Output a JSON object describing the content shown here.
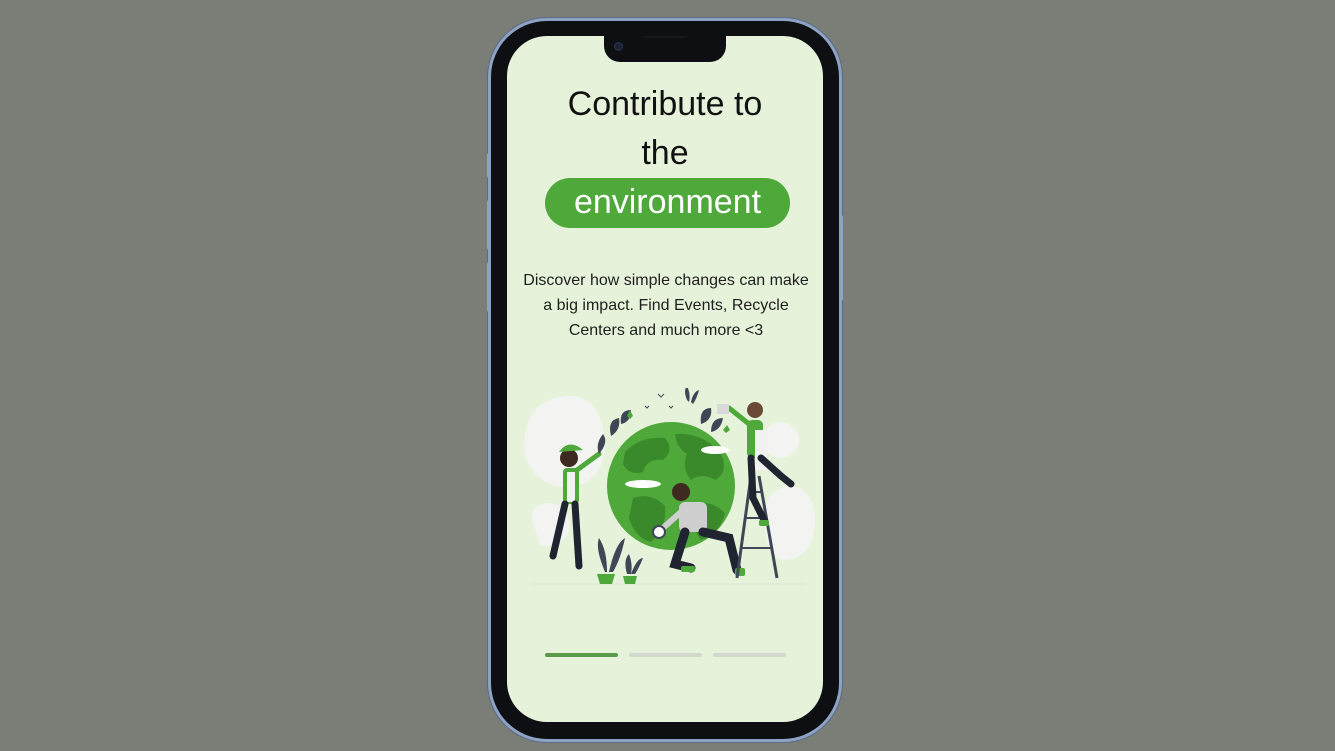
{
  "onboarding": {
    "title_line1": "Contribute to",
    "title_line2": "the",
    "highlight": "environment",
    "description": "Discover how simple changes can make a big impact. Find Events, Recycle Centers and much more <3",
    "illustration": "earth-care-illustration",
    "pagination": {
      "total": 3,
      "active": 1
    }
  },
  "colors": {
    "background": "#7a7e77",
    "screen": "#e6f3da",
    "accent": "#4ea83a",
    "pager_active": "#5a9a4a",
    "pager_inactive": "#d3d8cf"
  }
}
